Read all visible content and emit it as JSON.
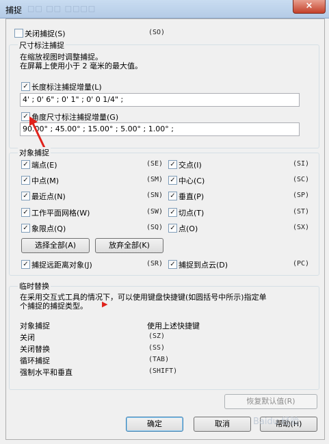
{
  "window": {
    "title": "捕捉",
    "close": "×",
    "bg_tabs": "□□  □□  □□□□"
  },
  "close_snap": {
    "label": "关闭捕捉(S)",
    "code": "(SO)",
    "checked": false
  },
  "dim_group": {
    "title": "尺寸标注捕捉",
    "desc1": "在缩放视图时调整捕捉。",
    "desc2": "在屏幕上使用小于 2 毫米的最大值。",
    "length": {
      "label": "长度标注捕捉增量(L)",
      "checked": true,
      "value": "4'  ;  0'  6\"  ;  0'  1\"  ;  0'  0 1/4\"  ;"
    },
    "angle": {
      "label": "角度尺寸标注捕捉增量(G)",
      "checked": true,
      "value": "90.00°  ;  45.00°  ;  15.00°  ;  5.00°  ;  1.00°  ;"
    }
  },
  "obj_group": {
    "title": "对象捕捉",
    "left": [
      {
        "label": "端点(E)",
        "code": "(SE)"
      },
      {
        "label": "中点(M)",
        "code": "(SM)"
      },
      {
        "label": "最近点(N)",
        "code": "(SN)"
      },
      {
        "label": "工作平面网格(W)",
        "code": "(SW)"
      },
      {
        "label": "象限点(Q)",
        "code": "(SQ)"
      }
    ],
    "right": [
      {
        "label": "交点(I)",
        "code": "(SI)"
      },
      {
        "label": "中心(C)",
        "code": "(SC)"
      },
      {
        "label": "垂直(P)",
        "code": "(SP)"
      },
      {
        "label": "切点(T)",
        "code": "(ST)"
      },
      {
        "label": "点(O)",
        "code": "(SX)"
      }
    ],
    "select_all": "选择全部(A)",
    "clear_all": "放弃全部(K)",
    "remote": {
      "label": "捕捉远距离对象(J)",
      "code": "(SR)"
    },
    "cloud": {
      "label": "捕捉到点云(D)",
      "code": "(PC)"
    }
  },
  "temp_group": {
    "title": "临时替换",
    "desc1": "在采用交互式工具的情况下，可以使用键盘快捷键(如圆括号中所示)指定单",
    "desc2": "个捕捉的捕捉类型。",
    "col1": "对象捕捉",
    "col2": "使用上述快捷键",
    "rows": [
      {
        "name": "关闭",
        "code": "(SZ)"
      },
      {
        "name": "关闭替换",
        "code": "(SS)"
      },
      {
        "name": "循环捕捉",
        "code": "(TAB)"
      },
      {
        "name": "强制水平和垂直",
        "code": "(SHIFT)"
      }
    ]
  },
  "buttons": {
    "restore": "恢复默认值(R)",
    "ok": "确定",
    "cancel": "取消",
    "help": "帮助(H)"
  },
  "check_mark": "✓",
  "arrow_glyph": "▶",
  "watermark": "Baidu 经验",
  "colors": {
    "arrow": "#e0231c",
    "titlebar": "#c9dcf1",
    "close": "#c4412a"
  }
}
